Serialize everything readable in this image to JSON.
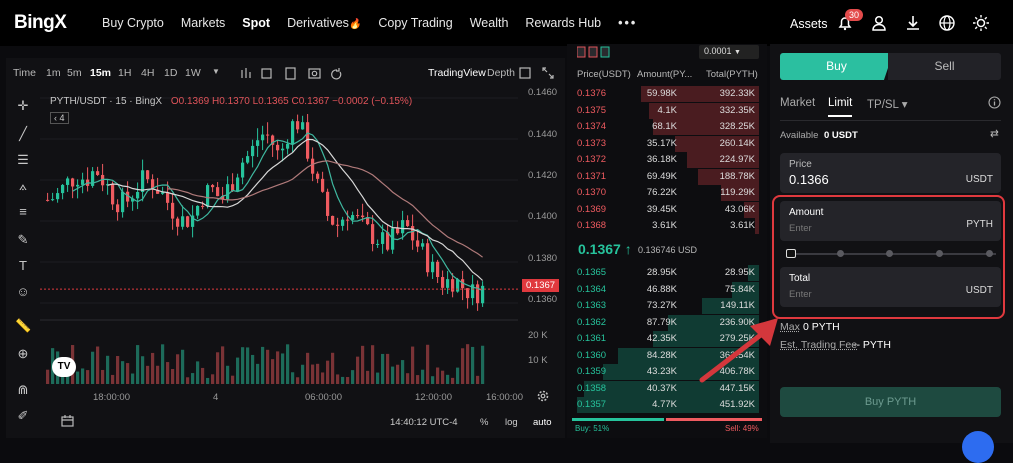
{
  "brand": "BingX",
  "nav": [
    "Buy Crypto",
    "Markets",
    "Spot",
    "Derivatives",
    "Copy Trading",
    "Wealth",
    "Rewards Hub"
  ],
  "nav_more": "•••",
  "assets": "Assets",
  "notif_count": "30",
  "timeframes": [
    "Time",
    "1m",
    "5m",
    "15m",
    "1H",
    "4H",
    "1D",
    "1W"
  ],
  "chart_tabs": [
    "TradingView",
    "Depth"
  ],
  "legend": {
    "pair": "PYTH/USDT · 15 · BingX",
    "ohlc": "O0.1369 H0.1370 L0.1365 C0.1367 −0.0002 (−0.15%)",
    "collapse": "4"
  },
  "price_axis": [
    "0.1460",
    "0.1440",
    "0.1420",
    "0.1400",
    "0.1380",
    "0.1367",
    "0.1360"
  ],
  "vol_axis": [
    "20 K",
    "10 K"
  ],
  "time_axis": [
    "18:00:00",
    "4",
    "06:00:00",
    "12:00:00",
    "16:00:00"
  ],
  "footer": {
    "clock": "14:40:12 UTC-4",
    "pct": "%",
    "log": "log",
    "auto": "auto"
  },
  "orderbook": {
    "precision": "0.0001",
    "headers": [
      "Price(USDT)",
      "Amount(PY...",
      "Total(PYTH)"
    ],
    "asks": [
      {
        "p": "0.1376",
        "a": "59.98K",
        "t": "392.33K",
        "w": 0.62
      },
      {
        "p": "0.1375",
        "a": "4.1K",
        "t": "332.35K",
        "w": 0.58
      },
      {
        "p": "0.1374",
        "a": "68.1K",
        "t": "328.25K",
        "w": 0.56
      },
      {
        "p": "0.1373",
        "a": "35.17K",
        "t": "260.14K",
        "w": 0.44
      },
      {
        "p": "0.1372",
        "a": "36.18K",
        "t": "224.97K",
        "w": 0.38
      },
      {
        "p": "0.1371",
        "a": "69.49K",
        "t": "188.78K",
        "w": 0.32
      },
      {
        "p": "0.1370",
        "a": "76.22K",
        "t": "119.29K",
        "w": 0.2
      },
      {
        "p": "0.1369",
        "a": "39.45K",
        "t": "43.06K",
        "w": 0.08
      },
      {
        "p": "0.1368",
        "a": "3.61K",
        "t": "3.61K",
        "w": 0.02
      }
    ],
    "last_price": "0.1367 ↑",
    "last_usd": "0.136746 USD",
    "bids": [
      {
        "p": "0.1365",
        "a": "28.95K",
        "t": "28.95K",
        "w": 0.06
      },
      {
        "p": "0.1364",
        "a": "46.88K",
        "t": "75.84K",
        "w": 0.14
      },
      {
        "p": "0.1363",
        "a": "73.27K",
        "t": "149.11K",
        "w": 0.3
      },
      {
        "p": "0.1362",
        "a": "87.79K",
        "t": "236.90K",
        "w": 0.48
      },
      {
        "p": "0.1361",
        "a": "42.35K",
        "t": "279.25K",
        "w": 0.56
      },
      {
        "p": "0.1360",
        "a": "84.28K",
        "t": "363.54K",
        "w": 0.74
      },
      {
        "p": "0.1359",
        "a": "43.23K",
        "t": "406.78K",
        "w": 0.82
      },
      {
        "p": "0.1358",
        "a": "40.37K",
        "t": "447.15K",
        "w": 0.92
      },
      {
        "p": "0.1357",
        "a": "4.77K",
        "t": "451.92K",
        "w": 0.96
      }
    ],
    "buy_pct": "Buy: 51%",
    "sell_pct": "Sell: 49%"
  },
  "trade": {
    "buy": "Buy",
    "sell": "Sell",
    "tabs": [
      "Market",
      "Limit",
      "TP/SL ▾"
    ],
    "available_label": "Available",
    "available_value": "0  USDT",
    "price_label": "Price",
    "price_value": "0.1366",
    "price_unit": "USDT",
    "amount_label": "Amount",
    "amount_placeholder": "Enter",
    "amount_unit": "PYTH",
    "total_label": "Total",
    "total_placeholder": "Enter",
    "total_unit": "USDT",
    "max_label": "Max",
    "max_value": "0 PYTH",
    "fee_label": "Est. Trading Fee",
    "fee_value": "-- PYTH",
    "submit": "Buy PYTH"
  },
  "colors": {
    "up": "#26c39c",
    "down": "#ef5b60",
    "accent": "#2bbfa0",
    "highlight": "#e0393e"
  }
}
